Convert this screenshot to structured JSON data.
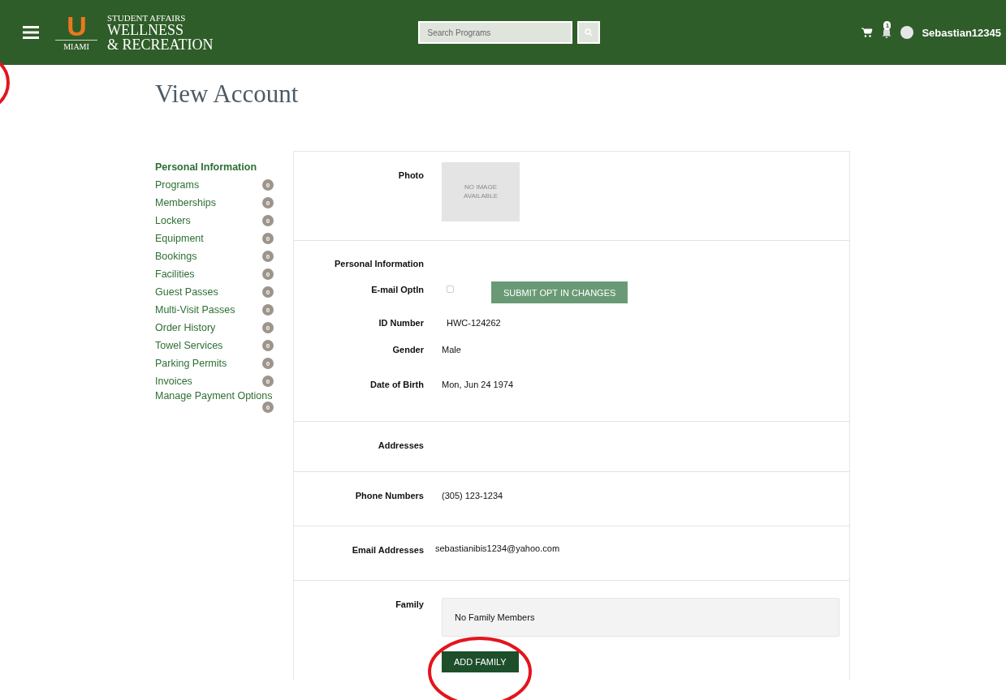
{
  "header": {
    "logo_letter": "U",
    "logo_caption": "MIAMI",
    "brand_top": "STUDENT AFFAIRS",
    "brand_line1": "WELLNESS",
    "brand_line2": "& RECREATION",
    "search": {
      "placeholder": "Search Programs"
    },
    "notifications": "1",
    "username": "Sebastian12345"
  },
  "page_title": "View Account",
  "sidebar": {
    "items": [
      {
        "label": "Personal Information",
        "selected": true
      },
      {
        "label": "Programs",
        "count": "0",
        "selected": false
      },
      {
        "label": "Memberships",
        "count": "0",
        "selected": false
      },
      {
        "label": "Lockers",
        "count": "0",
        "selected": false
      },
      {
        "label": "Equipment",
        "count": "0",
        "selected": false
      },
      {
        "label": "Bookings",
        "count": "0",
        "selected": false
      },
      {
        "label": "Facilities",
        "count": "0",
        "selected": false
      },
      {
        "label": "Guest Passes",
        "count": "0",
        "selected": false
      },
      {
        "label": "Multi-Visit Passes",
        "count": "0",
        "selected": false
      },
      {
        "label": "Order History",
        "count": "0",
        "selected": false
      },
      {
        "label": "Towel Services",
        "count": "0",
        "selected": false
      },
      {
        "label": "Parking Permits",
        "count": "0",
        "selected": false
      },
      {
        "label": "Invoices",
        "count": "0",
        "selected": false
      },
      {
        "label": "Manage Payment Options",
        "count": "0",
        "selected": false
      }
    ]
  },
  "photo": {
    "label": "Photo",
    "placeholder_text": "NO IMAGE AVAILABLE"
  },
  "personal": {
    "heading": "Personal Information",
    "email_optin": {
      "label": "E-mail OptIn",
      "checked": false,
      "button": "SUBMIT OPT IN CHANGES"
    },
    "fields": [
      {
        "label": "ID Number",
        "value": "HWC-124262"
      },
      {
        "label": "Gender",
        "value": "Male"
      },
      {
        "label": "Date of Birth",
        "value": "Mon, Jun 24 1974"
      }
    ]
  },
  "addresses": {
    "label": "Addresses"
  },
  "phone": {
    "label": "Phone Numbers",
    "value": "(305) 123-1234"
  },
  "email": {
    "label": "Email Addresses",
    "value": "sebastianibis1234@yahoo.com"
  },
  "family": {
    "label": "Family",
    "empty_text": "No Family Members",
    "button": "ADD FAMILY"
  }
}
